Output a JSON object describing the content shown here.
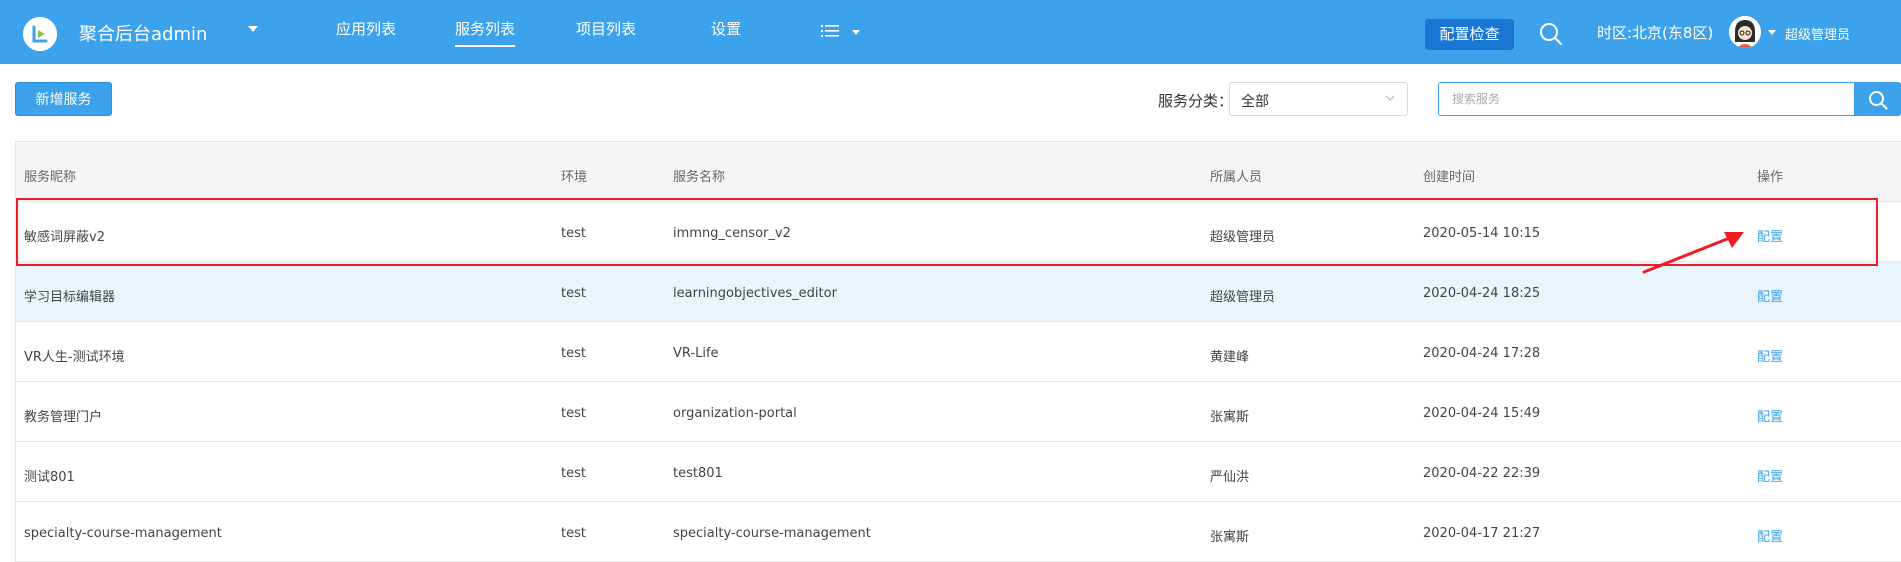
{
  "header": {
    "app_title": "聚合后台admin",
    "nav": [
      {
        "label": "应用列表"
      },
      {
        "label": "服务列表",
        "active": true
      },
      {
        "label": "项目列表"
      },
      {
        "label": "设置"
      }
    ],
    "config_check_label": "配置检查",
    "timezone": "时区:北京(东8区)",
    "username": "超级管理员"
  },
  "toolbar": {
    "add_label": "新增服务",
    "category_label": "服务分类：",
    "category_value": "全部",
    "search_placeholder": "搜索服务"
  },
  "table": {
    "columns": [
      "服务昵称",
      "环境",
      "服务名称",
      "所属人员",
      "创建时间",
      "操作"
    ],
    "rows": [
      {
        "nickname": "敏感词屏蔽v2",
        "env": "test",
        "name": "immng_censor_v2",
        "owner": "超级管理员",
        "created": "2020-05-14 10:15",
        "action": "配置"
      },
      {
        "nickname": "学习目标编辑器",
        "env": "test",
        "name": "learningobjectives_editor",
        "owner": "超级管理员",
        "created": "2020-04-24 18:25",
        "action": "配置"
      },
      {
        "nickname": "VR人生-测试环境",
        "env": "test",
        "name": "VR-Life",
        "owner": "黄建峰",
        "created": "2020-04-24 17:28",
        "action": "配置"
      },
      {
        "nickname": "教务管理门户",
        "env": "test",
        "name": "organization-portal",
        "owner": "张寓斯",
        "created": "2020-04-24 15:49",
        "action": "配置"
      },
      {
        "nickname": "测试801",
        "env": "test",
        "name": "test801",
        "owner": "严仙洪",
        "created": "2020-04-22 22:39",
        "action": "配置"
      },
      {
        "nickname": "specialty-course-management",
        "env": "test",
        "name": "specialty-course-management",
        "owner": "张寓斯",
        "created": "2020-04-17 21:27",
        "action": "配置"
      }
    ]
  },
  "colors": {
    "brand": "#3da2ec",
    "config_check_bg": "#1976d2",
    "annotation": "#ee1c24",
    "row_hover": "#eaf4fd"
  },
  "icons": [
    "logo-icon",
    "chevron-down-icon",
    "list-menu-icon",
    "search-icon",
    "avatar",
    "arrow-annotation"
  ]
}
